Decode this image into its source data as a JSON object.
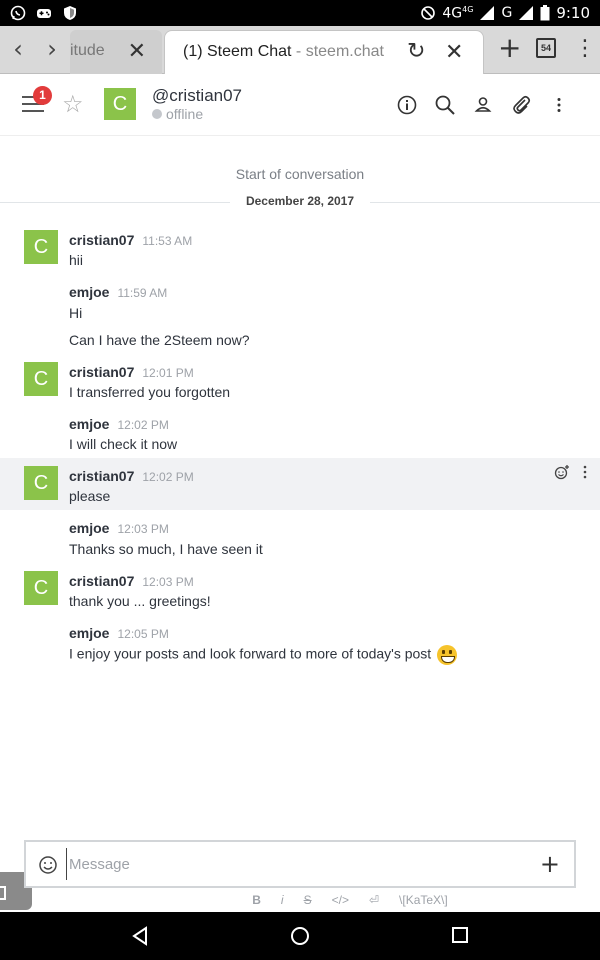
{
  "status_bar": {
    "network": "4G",
    "network_sup": "4G",
    "carrier_signal": "G",
    "time": "9:10",
    "icons": [
      "whatsapp-icon",
      "gamepad-icon",
      "shield-icon",
      "mute-icon",
      "signal-icon",
      "battery-icon"
    ]
  },
  "browser": {
    "inactive_tab": {
      "title": "itude"
    },
    "active_tab": {
      "title": "(1) Steem Chat",
      "domain": " - steem.chat"
    },
    "tab_count": "54"
  },
  "header": {
    "badge_count": "1",
    "room_avatar_letter": "C",
    "room_name": "@cristian07",
    "room_status": "offline",
    "icons": [
      "info-icon",
      "search-icon",
      "user-icon",
      "paperclip-icon",
      "kebab-icon"
    ]
  },
  "conversation": {
    "start_label": "Start of conversation",
    "date_label": "December 28, 2017"
  },
  "messages": [
    {
      "author": "cristian07",
      "time": "11:53 AM",
      "avatar": "C",
      "text": "hii"
    },
    {
      "author": "emjoe",
      "time": "11:59 AM",
      "text": "Hi",
      "text2": "Can I have the 2Steem now?"
    },
    {
      "author": "cristian07",
      "time": "12:01 PM",
      "avatar": "C",
      "text": "I transferred you forgotten"
    },
    {
      "author": "emjoe",
      "time": "12:02 PM",
      "text": "I will check it now"
    },
    {
      "author": "cristian07",
      "time": "12:02 PM",
      "avatar": "C",
      "text": "please",
      "highlighted": true
    },
    {
      "author": "emjoe",
      "time": "12:03 PM",
      "text": "Thanks so much, I have seen it"
    },
    {
      "author": "cristian07",
      "time": "12:03 PM",
      "avatar": "C",
      "text": "thank you ... greetings!"
    },
    {
      "author": "emjoe",
      "time": "12:05 PM",
      "text": "I enjoy your posts and look forward to more of today's post"
    }
  ],
  "composer": {
    "placeholder": "Message",
    "value": ""
  },
  "format_bar": {
    "bold": "B",
    "italic": "i",
    "strike": "S",
    "code": "</>",
    "multiline": "⏎",
    "katex": "\\[KaTeX\\]"
  }
}
